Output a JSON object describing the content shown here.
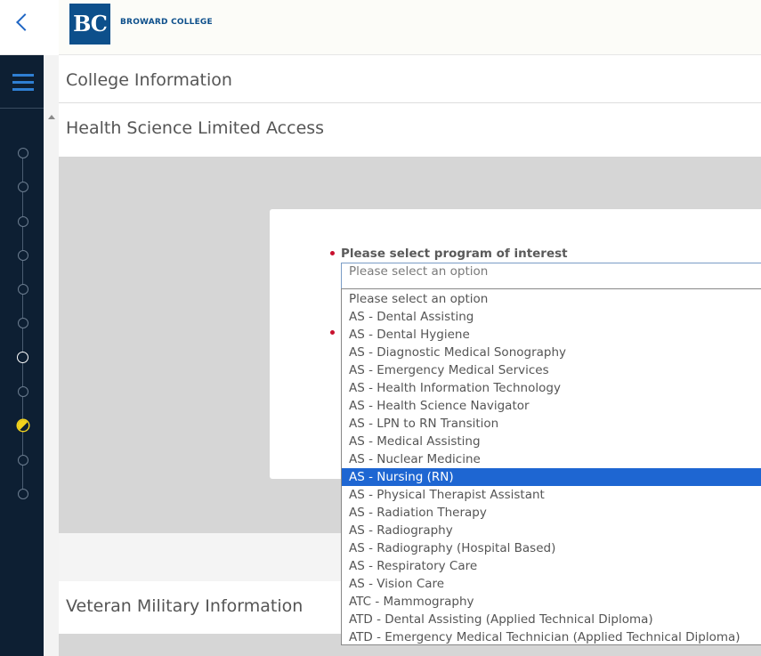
{
  "header": {
    "logo_initials": "BC",
    "logo_text": "BROWARD COLLEGE"
  },
  "sidebar": {
    "back_icon": "chevron-left-icon",
    "menu_icon": "hamburger-icon",
    "step_states": [
      "incomplete",
      "incomplete",
      "incomplete",
      "incomplete",
      "incomplete",
      "incomplete",
      "current",
      "incomplete",
      "partial",
      "incomplete",
      "incomplete"
    ]
  },
  "sections": {
    "college_info_title": "College Information",
    "health_title": "Health Science Limited Access",
    "veteran_title": "Veteran Military Information"
  },
  "form": {
    "program_label": "Please select program of interest",
    "program_value": "Please select an option",
    "selected_index": 10,
    "options": [
      "Please select an option",
      "AS - Dental Assisting",
      "AS - Dental Hygiene",
      "AS - Diagnostic Medical Sonography",
      "AS - Emergency Medical Services",
      "AS - Health Information Technology",
      "AS - Health Science Navigator",
      "AS - LPN to RN Transition",
      "AS - Medical Assisting",
      "AS - Nuclear Medicine",
      "AS - Nursing (RN)",
      "AS - Physical Therapist Assistant",
      "AS - Radiation Therapy",
      "AS - Radiography",
      "AS - Radiography (Hospital Based)",
      "AS - Respiratory Care",
      "AS - Vision Care",
      "ATC - Mammography",
      "ATD - Dental Assisting (Applied Technical Diploma)",
      "ATD - Emergency Medical Technician (Applied Technical Diploma)"
    ]
  },
  "colors": {
    "sidebar_bg": "#0d1f33",
    "brand_blue": "#0d4f8b",
    "accent_blue": "#2f7fd3",
    "highlight": "#1e66d2",
    "required_red": "#c8102e",
    "step_partial": "#f2d31c"
  }
}
